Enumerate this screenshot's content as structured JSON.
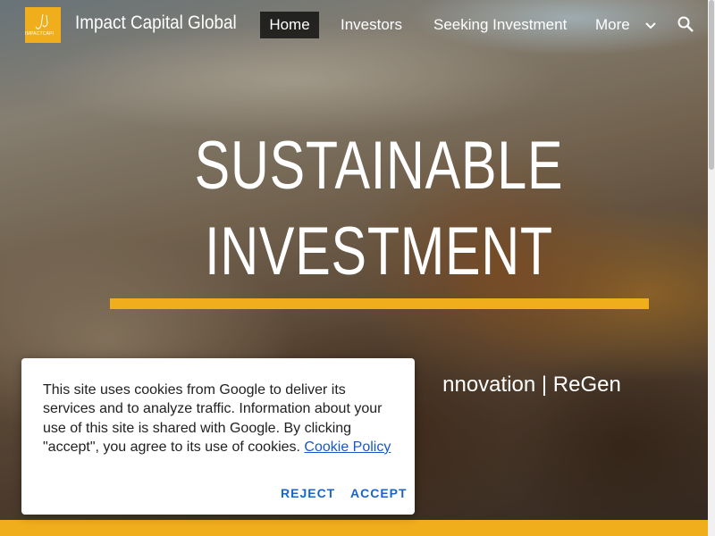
{
  "header": {
    "logo_text": "IMPACTCAPI",
    "site_title": "Impact Capital Global",
    "nav": {
      "home": "Home",
      "investors": "Investors",
      "seeking": "Seeking Investment",
      "more": "More"
    },
    "icons": {
      "more": "chevron-down-icon",
      "search": "search-icon"
    }
  },
  "hero": {
    "title_line1": "SUSTAINABLE",
    "title_line2": "INVESTMENT",
    "subtitle": "nnovation | ReGen"
  },
  "cookie_dialog": {
    "message": "This site uses cookies from Google to deliver its services and to analyze traffic. Information about your use of this site is shared with Google. By clicking \"accept\", you agree to its use of cookies.",
    "link_text": "Cookie Policy",
    "reject_label": "REJECT",
    "accept_label": "ACCEPT"
  },
  "colors": {
    "accent": "#f0ad1c",
    "link": "#1a57c6",
    "button_text": "#1a66c8",
    "nav_active_bg": "#1a1a1a"
  }
}
